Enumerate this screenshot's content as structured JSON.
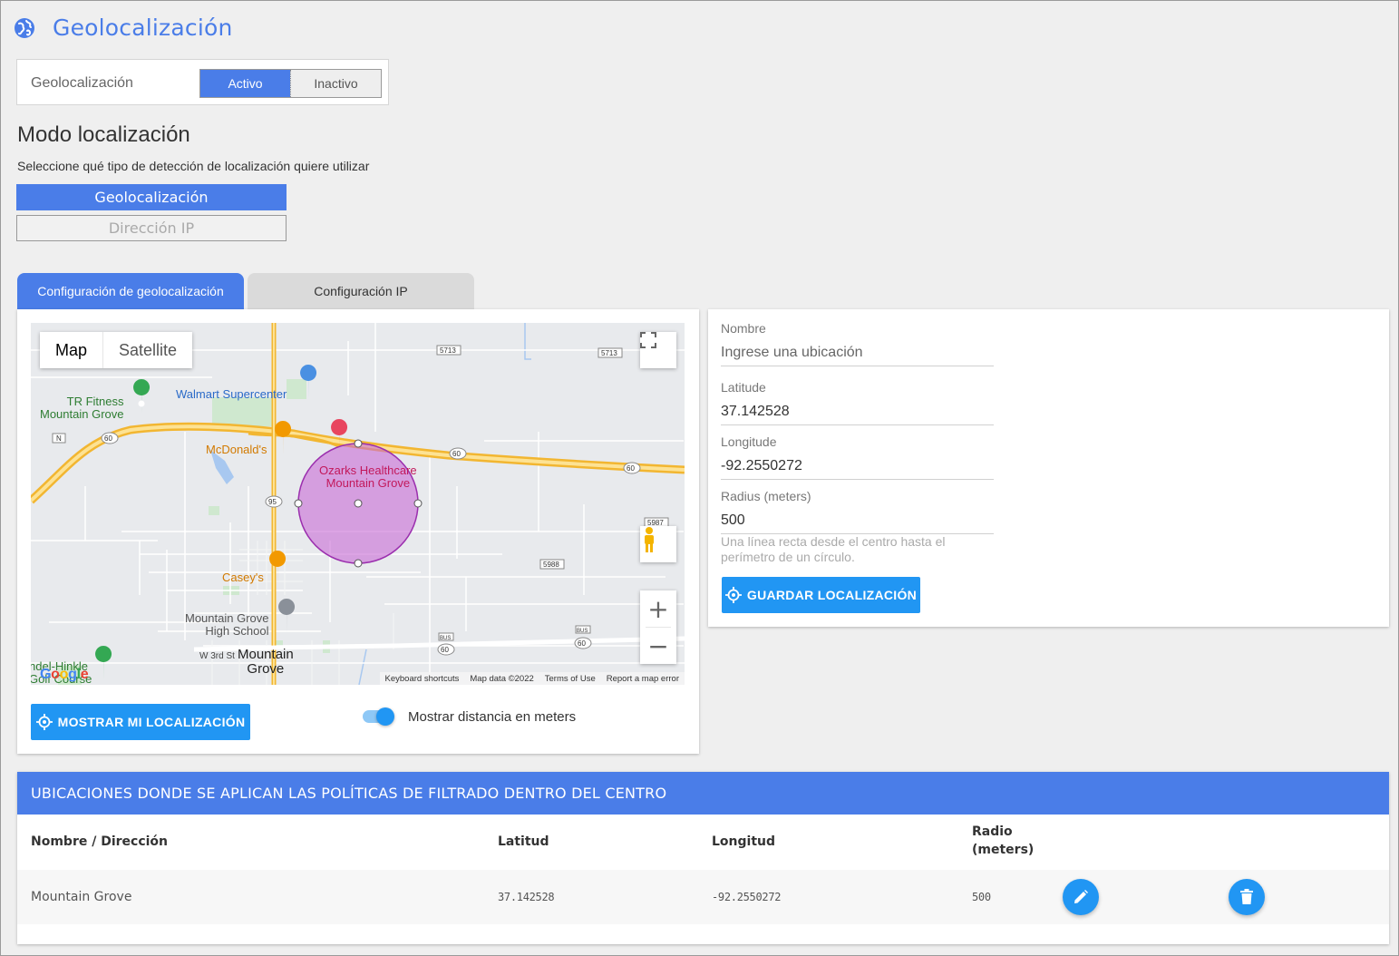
{
  "header": {
    "title": "Geolocalización",
    "icon": "globe-icon"
  },
  "status": {
    "label": "Geolocalización",
    "active_label": "Activo",
    "inactive_label": "Inactivo",
    "selected": "Activo"
  },
  "mode": {
    "title": "Modo localización",
    "subtitle": "Seleccione qué tipo de detección de localización quiere utilizar",
    "options": [
      "Geolocalización",
      "Dirección IP"
    ],
    "selected": "Geolocalización"
  },
  "tabs": [
    {
      "label": "Configuración de geolocalización",
      "active": true
    },
    {
      "label": "Configuración IP",
      "active": false
    }
  ],
  "map": {
    "type_map": "Map",
    "type_satellite": "Satellite",
    "google": "Google",
    "footer": [
      "Keyboard shortcuts",
      "Map data ©2022",
      "Terms of Use",
      "Report a map error"
    ],
    "labels": {
      "tr_fitness": "TR Fitness\nMountain Grove",
      "walmart": "Walmart Supercenter",
      "mcdonalds": "McDonald's",
      "ozarks": "Ozarks Healthcare\nMountain Grove",
      "caseys": "Casey's",
      "high_school": "Mountain Grove\nHigh School",
      "w3rd": "W 3rd St",
      "town": "Mountain\nGrove",
      "hinkle": "ndel-Hinkle\nGolf Course",
      "r5713a": "5713",
      "r5713b": "5713",
      "r60a": "60",
      "r60b": "60",
      "r60c": "60",
      "r60d": "60",
      "r60e": "60",
      "r95": "95",
      "rN": "N",
      "r5988": "5988",
      "r5987": "5987",
      "bus": "BUS"
    },
    "circle_center": [
      37.142528,
      -92.2550272
    ],
    "circle_radius_m": 500
  },
  "controls": {
    "show_location": "MOSTRAR MI LOCALIZACIÓN",
    "distance_toggle_label": "Mostrar distancia en meters",
    "distance_toggle_on": true
  },
  "form": {
    "name_label": "Nombre",
    "name_placeholder": "Ingrese una ubicación",
    "name_value": "",
    "lat_label": "Latitude",
    "lat_value": "37.142528",
    "lng_label": "Longitude",
    "lng_value": "-92.2550272",
    "radius_label": "Radius (meters)",
    "radius_value": "500",
    "help": "Una línea recta desde el centro hasta el perímetro de un círculo.",
    "save": "GUARDAR LOCALIZACIÓN"
  },
  "table": {
    "title": "UBICACIONES DONDE SE APLICAN LAS POLÍTICAS DE FILTRADO DENTRO DEL CENTRO",
    "headers": {
      "name": "Nombre / Dirección",
      "lat": "Latitud",
      "lng": "Longitud",
      "radius": "Radio\n(meters)"
    },
    "rows": [
      {
        "name": "Mountain Grove",
        "lat": "37.142528",
        "lng": "-92.2550272",
        "radius": "500"
      }
    ]
  },
  "colors": {
    "primary": "#4a7de8",
    "button": "#2196f3",
    "circle": "#c86ad6"
  }
}
